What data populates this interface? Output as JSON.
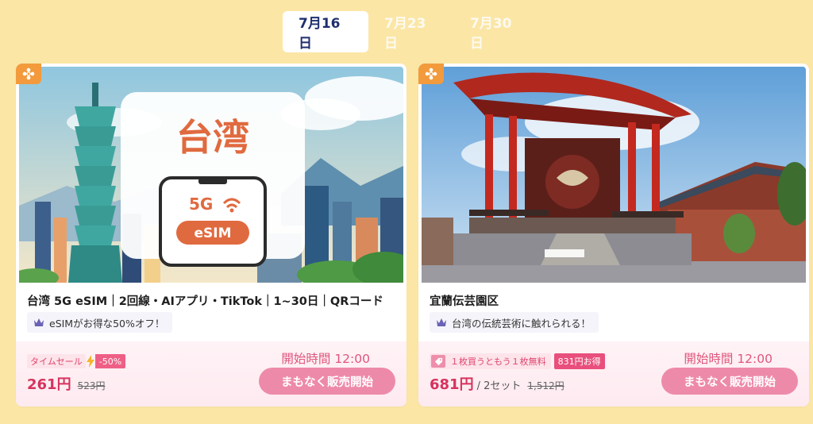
{
  "tabs": [
    {
      "label": "7月16日",
      "active": true
    },
    {
      "label": "7月23日",
      "active": false
    },
    {
      "label": "7月30日",
      "active": false
    }
  ],
  "colors": {
    "background": "#fbe6a6",
    "accent_pink": "#ee8aa9",
    "price_red": "#d6335e",
    "badge_orange": "#f29a3c"
  },
  "cards": [
    {
      "image_text": {
        "headline": "台湾",
        "network": "5G",
        "product": "eSIM"
      },
      "corner_icon": "flower-badge-icon",
      "title": "台湾 5G eSIM｜2回線・AIアプリ・TikTok｜1~30日｜QRコード",
      "promo": "eSIMがお得な50%オフ！",
      "tag_sale": "タイムセール",
      "tag_discount": "-50%",
      "price": "261円",
      "price_old": "523円",
      "start_time": "開始時間 12:00",
      "cta": "まもなく販売開始"
    },
    {
      "corner_icon": "flower-badge-icon",
      "title": "宜蘭伝芸園区",
      "promo": "台湾の伝統芸術に触れられる！",
      "tag_buy": "１枚買うともう１枚無料",
      "tag_save": "831円お得",
      "price": "681円",
      "price_unit": "/ 2セット",
      "price_old": "1,512円",
      "start_time": "開始時間 12:00",
      "cta": "まもなく販売開始"
    }
  ]
}
